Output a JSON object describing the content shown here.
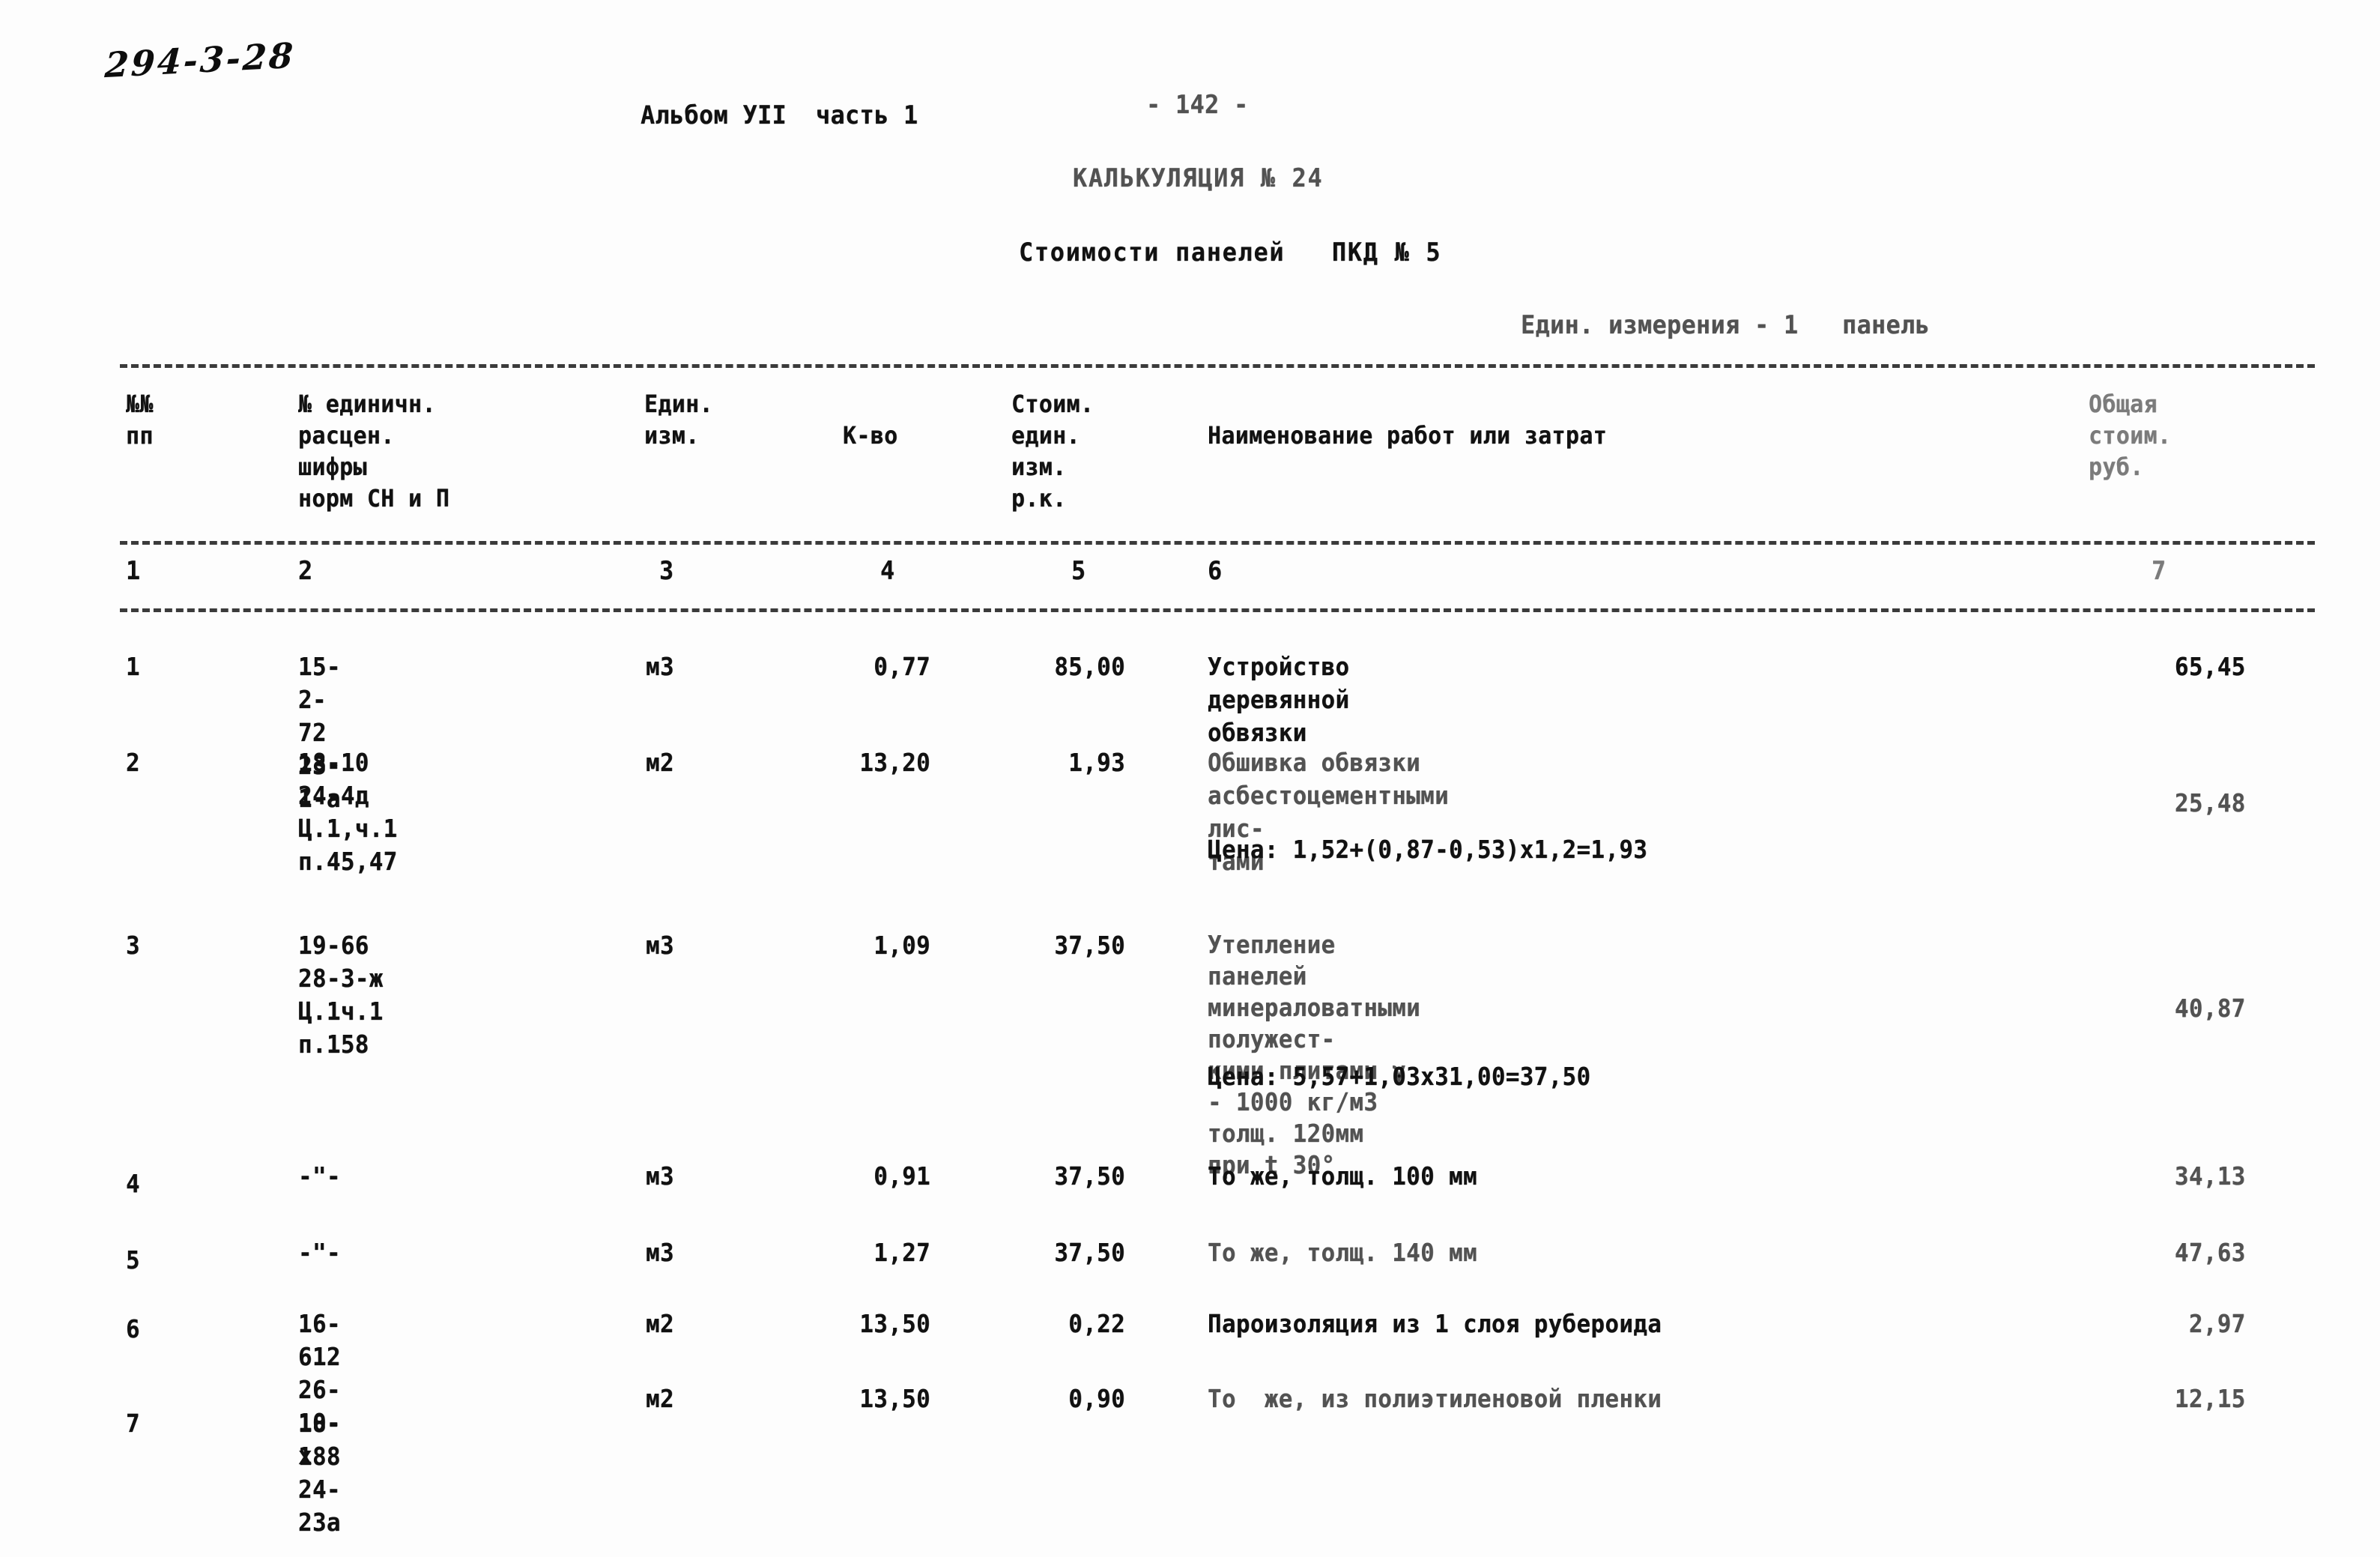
{
  "header": {
    "doc_code": "294-3-28",
    "album": "Альбом УII  часть 1",
    "page_number": "- 142 -",
    "calc_title": "КАЛЬКУЛЯЦИЯ № 24",
    "calc_subtitle": "Стоимости панелей   ПКД № 5",
    "unit_note": "Един. измерения - 1   панель"
  },
  "table": {
    "columns": [
      {
        "num": "1",
        "header": "№№\nпп"
      },
      {
        "num": "2",
        "header": "№ единичн.\nрасцен.\nшифры\nнорм СН и П"
      },
      {
        "num": "3",
        "header": "Един.\nизм."
      },
      {
        "num": "4",
        "header": "К-во"
      },
      {
        "num": "5",
        "header": "Стоим.\nедин.\nизм.\nр.к."
      },
      {
        "num": "6",
        "header": "Наименование работ или затрат"
      },
      {
        "num": "7",
        "header": "Общая\nстоим.\nруб."
      }
    ],
    "rows": [
      {
        "no": "1",
        "code": "15-2-72\n23-1-а",
        "unit": "м3",
        "qty": "0,77",
        "unit_cost": "85,00",
        "description": "Устройство деревянной обвязки",
        "formula": "",
        "total": "65,45"
      },
      {
        "no": "2",
        "code": "18-10\n24-4д\nЦ.1,ч.1\nп.45,47",
        "unit": "м2",
        "qty": "13,20",
        "unit_cost": "1,93",
        "description": "Обшивка обвязки асбестоцементными лис-\nтами",
        "formula": "Цена: 1,52+(0,87-0,53)х1,2=1,93",
        "total": "25,48"
      },
      {
        "no": "3",
        "code": "19-66\n28-3-ж\nЦ.1ч.1\nп.158",
        "unit": "м3",
        "qty": "1,09",
        "unit_cost": "37,50",
        "description": "Утепление панелей минераловатными полужест-\nкими плитами γ - 1000 кг/м3 толщ. 120мм\nпри   t 30°",
        "formula": "Цена: 5,57+1,03х31,00=37,50",
        "total": "40,87"
      },
      {
        "no": "4",
        "code": "-\"-",
        "unit": "м3",
        "qty": "0,91",
        "unit_cost": "37,50",
        "description": "То же, толщ. 100 мм",
        "formula": "",
        "total": "34,13"
      },
      {
        "no": "5",
        "code": "-\"-",
        "unit": "м3",
        "qty": "1,27",
        "unit_cost": "37,50",
        "description": "То же, толщ. 140 мм",
        "formula": "",
        "total": "47,63"
      },
      {
        "no": "6",
        "code": "16-612\n26-10-х",
        "unit": "м2",
        "qty": "13,50",
        "unit_cost": "0,22",
        "description": "Пароизоляция из 1 слоя рубероида",
        "formula": "",
        "total": "2,97"
      },
      {
        "no": "7",
        "code": "18-188\n24-23а",
        "unit": "м2",
        "qty": "13,50",
        "unit_cost": "0,90",
        "description": "То  же, из полиэтиленовой пленки",
        "formula": "",
        "total": "12,15"
      }
    ]
  }
}
